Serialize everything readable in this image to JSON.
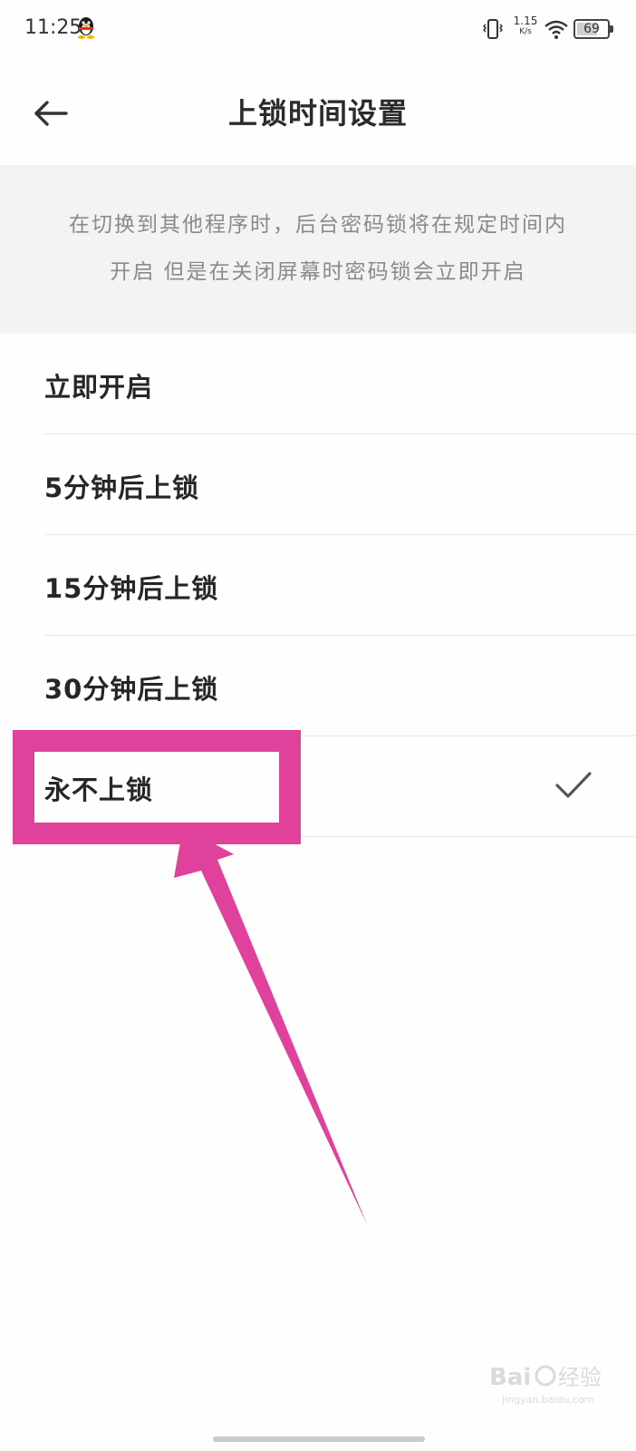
{
  "status_bar": {
    "time": "11:25",
    "speed_value": "1.15",
    "speed_unit": "K/s",
    "battery": "69"
  },
  "header": {
    "title": "上锁时间设置",
    "back_icon": "arrow-left-icon"
  },
  "description": {
    "line1": "在切换到其他程序时，后台密码锁将在规定时间内",
    "line2": "开启 但是在关闭屏幕时密码锁会立即开启"
  },
  "options": [
    {
      "label": "立即开启",
      "selected": false
    },
    {
      "label": "5分钟后上锁",
      "selected": false
    },
    {
      "label": "15分钟后上锁",
      "selected": false
    },
    {
      "label": "30分钟后上锁",
      "selected": false
    },
    {
      "label": "永不上锁",
      "selected": true
    }
  ],
  "annotation": {
    "color": "#e0419a"
  },
  "watermark": {
    "brand": "Bai du 经验",
    "url": "jingyan.baidu.com"
  }
}
